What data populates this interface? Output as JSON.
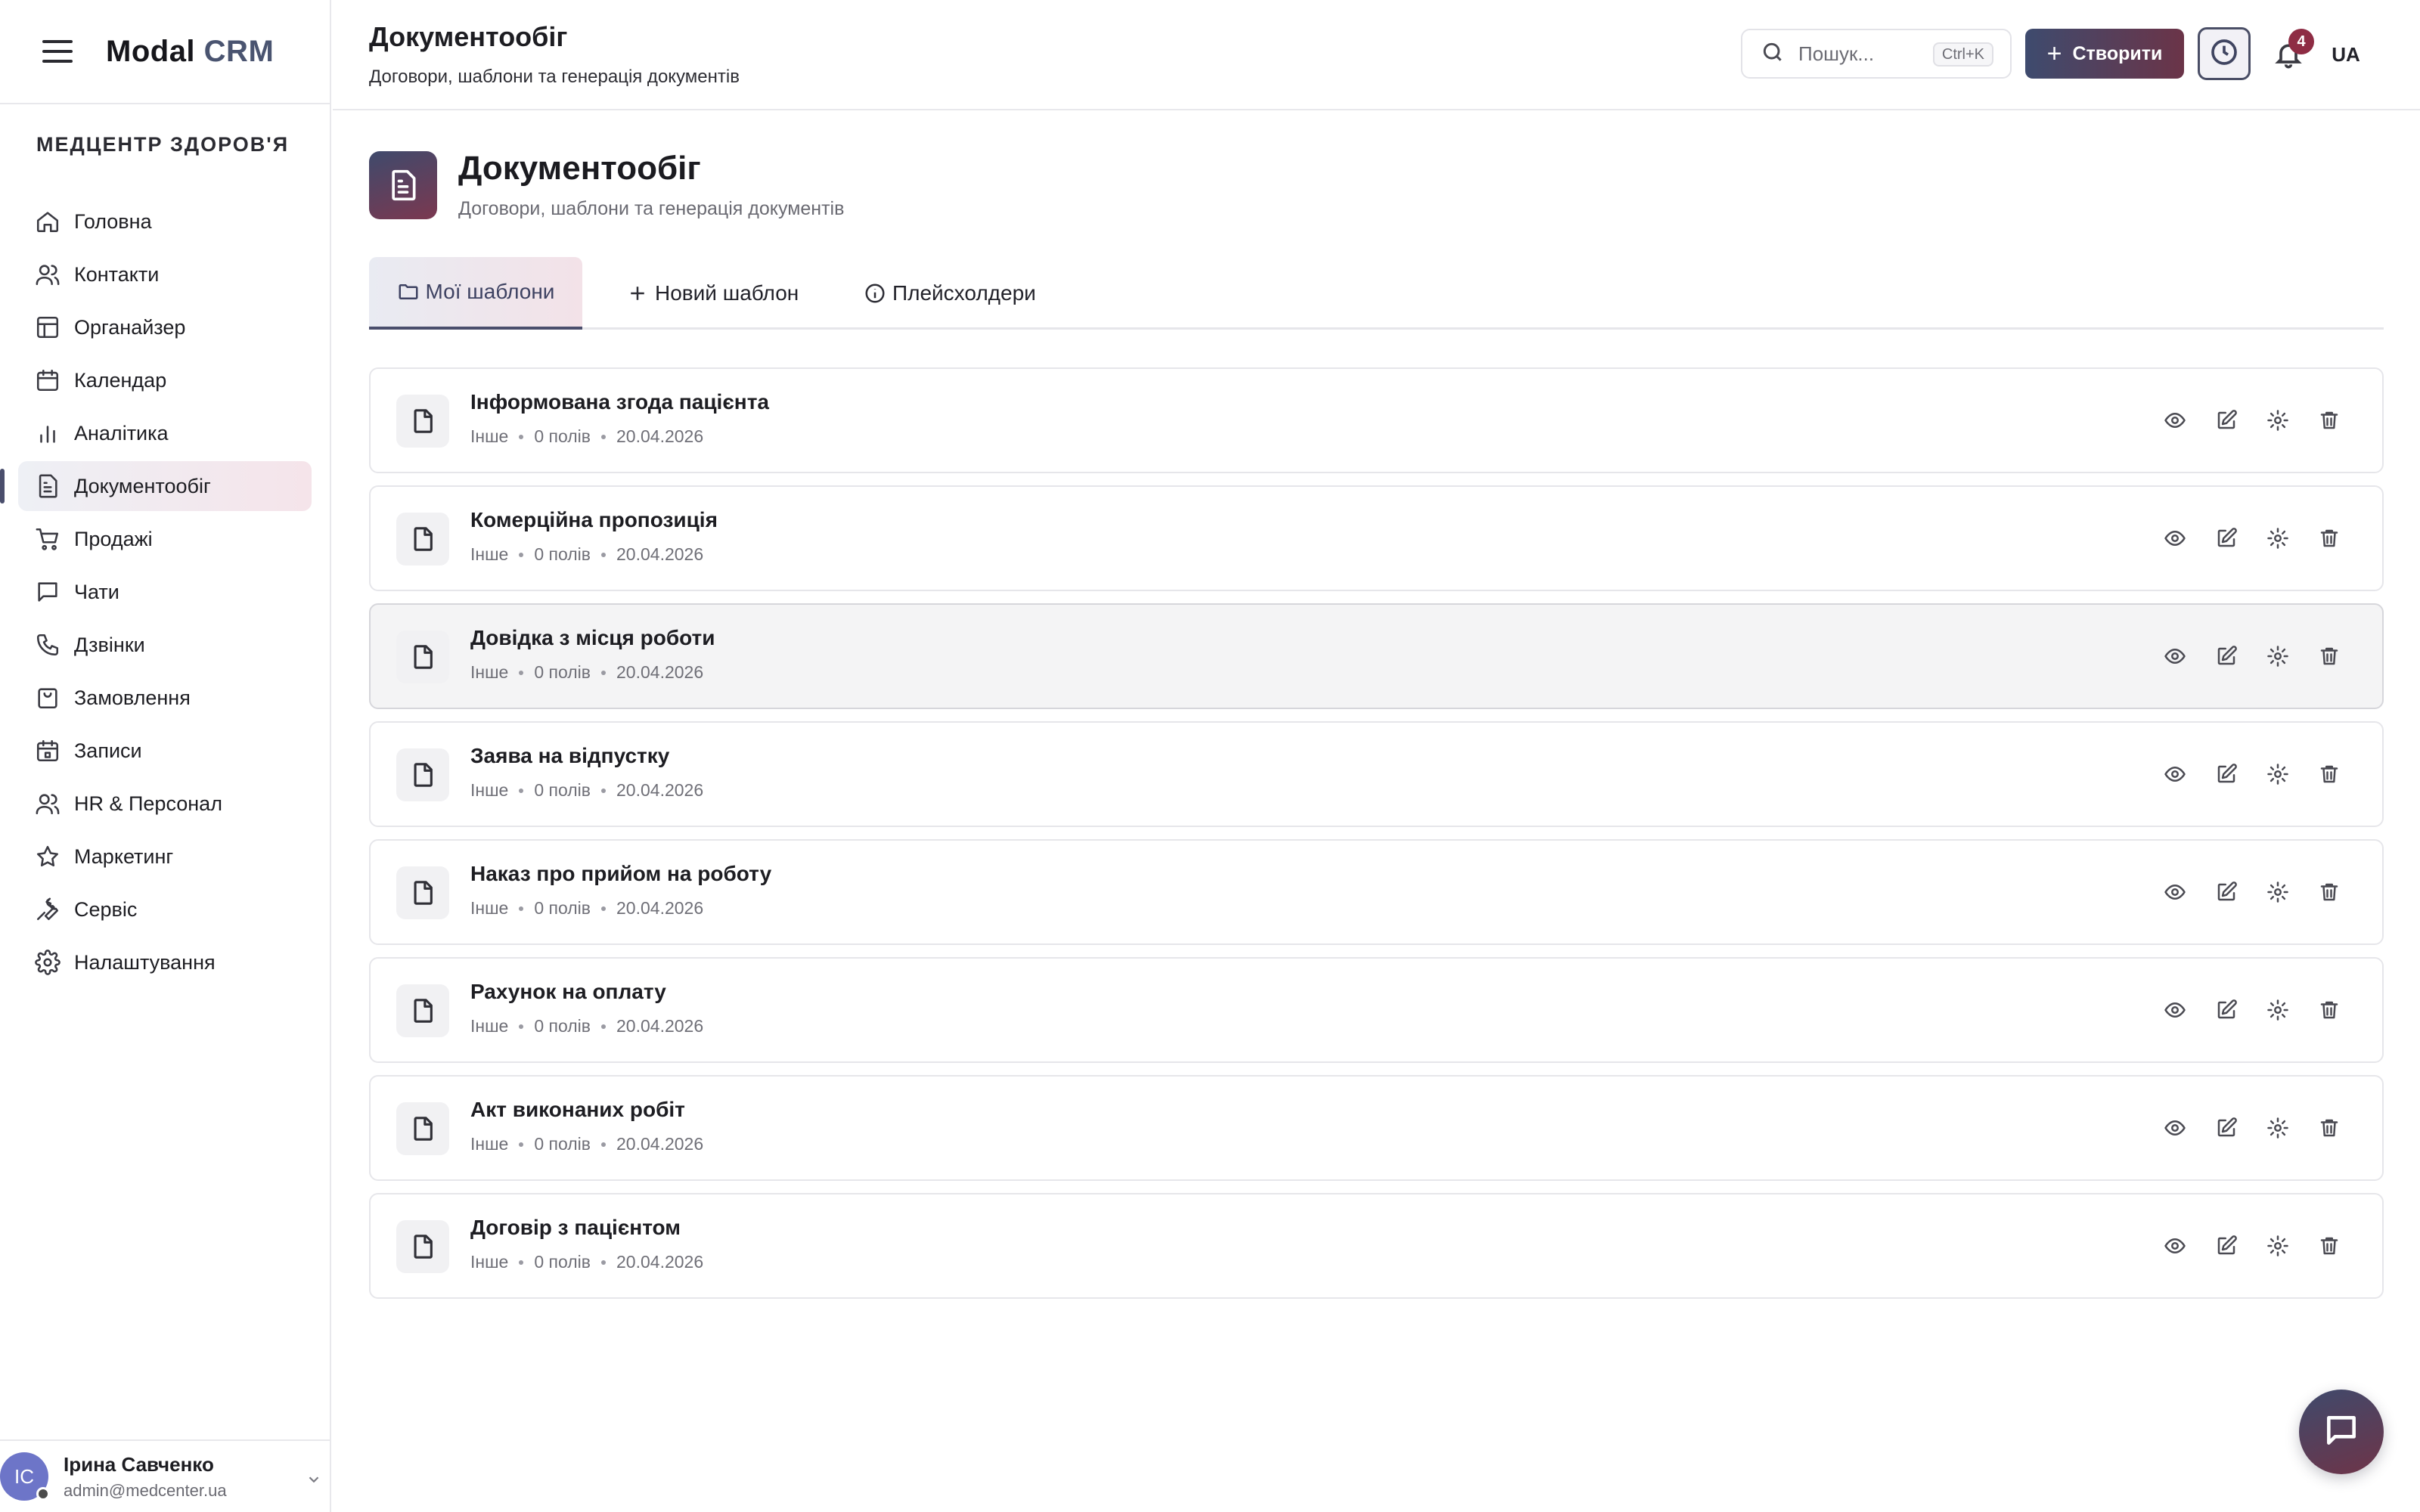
{
  "brand": {
    "name_main": "Modal",
    "name_accent": "CRM"
  },
  "org_name": "МЕДЦЕНТР ЗДОРОВ'Я",
  "sidebar": {
    "items": [
      {
        "label": "Головна",
        "icon": "home-icon"
      },
      {
        "label": "Контакти",
        "icon": "users-icon"
      },
      {
        "label": "Органайзер",
        "icon": "layout-icon"
      },
      {
        "label": "Календар",
        "icon": "calendar-icon"
      },
      {
        "label": "Аналітика",
        "icon": "bar-chart-icon"
      },
      {
        "label": "Документообіг",
        "icon": "document-icon",
        "active": true
      },
      {
        "label": "Продажі",
        "icon": "cart-icon"
      },
      {
        "label": "Чати",
        "icon": "chat-icon"
      },
      {
        "label": "Дзвінки",
        "icon": "phone-icon"
      },
      {
        "label": "Замовлення",
        "icon": "shopping-bag-icon"
      },
      {
        "label": "Записи",
        "icon": "calendar-check-icon"
      },
      {
        "label": "HR & Персонал",
        "icon": "team-icon"
      },
      {
        "label": "Маркетинг",
        "icon": "star-icon"
      },
      {
        "label": "Сервіс",
        "icon": "wrench-icon"
      },
      {
        "label": "Налаштування",
        "icon": "gear-icon"
      }
    ]
  },
  "user": {
    "initials": "IC",
    "name": "Ірина Савченко",
    "email": "admin@medcenter.ua"
  },
  "topbar": {
    "title": "Документообіг",
    "subtitle": "Договори, шаблони та генерація документів",
    "search_placeholder": "Пошук...",
    "search_shortcut": "Ctrl+K",
    "create_label": "Створити",
    "notification_count": "4",
    "language": "UA"
  },
  "page": {
    "title": "Документообіг",
    "subtitle": "Договори, шаблони та генерація документів"
  },
  "tabs": [
    {
      "label": "Мої шаблони",
      "icon": "folder-icon",
      "active": true
    },
    {
      "label": "Новий шаблон",
      "icon": "plus-icon"
    },
    {
      "label": "Плейсхолдери",
      "icon": "info-icon"
    }
  ],
  "templates": [
    {
      "title": "Інформована згода пацієнта",
      "category": "Інше",
      "fields": "0 полів",
      "date": "20.04.2026"
    },
    {
      "title": "Комерційна пропозиція",
      "category": "Інше",
      "fields": "0 полів",
      "date": "20.04.2026"
    },
    {
      "title": "Довідка з місця роботи",
      "category": "Інше",
      "fields": "0 полів",
      "date": "20.04.2026"
    },
    {
      "title": "Заява на відпустку",
      "category": "Інше",
      "fields": "0 полів",
      "date": "20.04.2026"
    },
    {
      "title": "Наказ про прийом на роботу",
      "category": "Інше",
      "fields": "0 полів",
      "date": "20.04.2026"
    },
    {
      "title": "Рахунок на оплату",
      "category": "Інше",
      "fields": "0 полів",
      "date": "20.04.2026"
    },
    {
      "title": "Акт виконаних робіт",
      "category": "Інше",
      "fields": "0 полів",
      "date": "20.04.2026"
    },
    {
      "title": "Договір з пацієнтом",
      "category": "Інше",
      "fields": "0 полів",
      "date": "20.04.2026"
    }
  ],
  "colors": {
    "accent_start": "#3e4b6e",
    "accent_end": "#6b3448",
    "badge": "#8e2c44"
  }
}
